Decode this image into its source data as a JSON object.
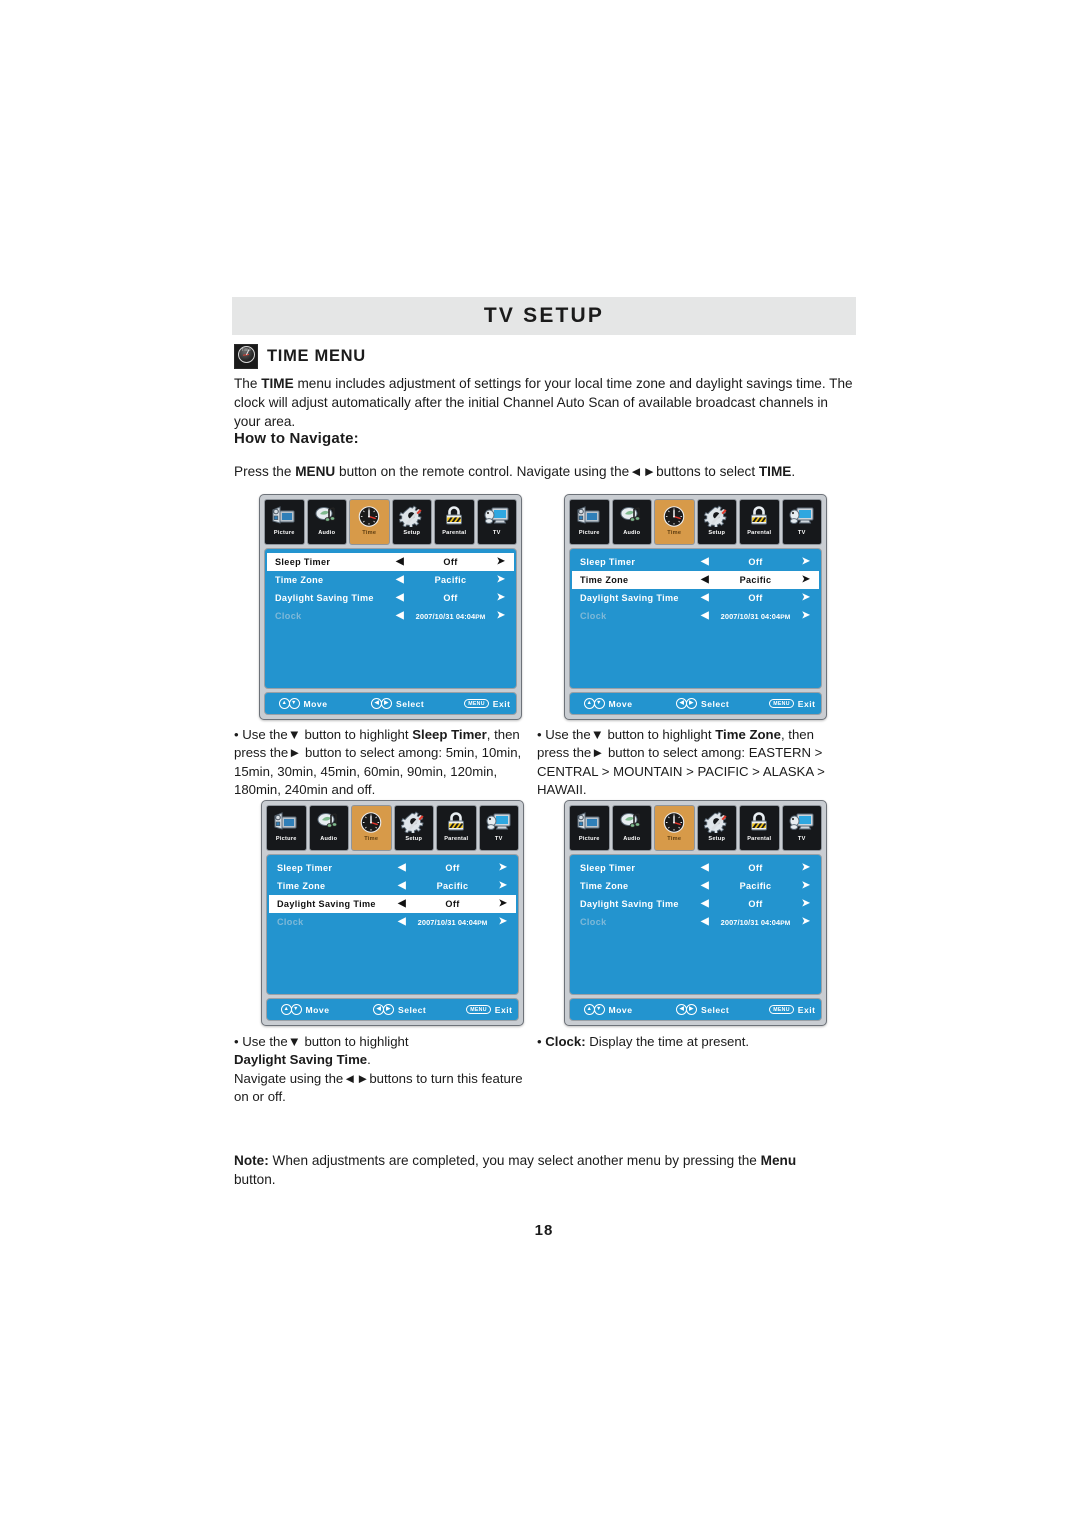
{
  "page": {
    "header_title": "TV SETUP",
    "page_number": "18"
  },
  "section": {
    "icon": "clock-icon",
    "icon_caption": "Time",
    "heading": "TIME MENU",
    "intro_html": "The <b>TIME</b> menu includes adjustment of settings for your local time zone and daylight savings time. The clock will adjust automatically after the initial Channel Auto Scan of available broadcast channels in your area.",
    "howto_heading": "How to Navigate:",
    "nav_html": "Press the <b>MENU</b> button on the remote control. Navigate using the&#9668;&#9658;buttons to select <b>TIME</b>."
  },
  "osd_common": {
    "tabs": [
      {
        "label": "Picture",
        "icon": "picture-icon",
        "active": false
      },
      {
        "label": "Audio",
        "icon": "audio-icon",
        "active": false
      },
      {
        "label": "Time",
        "icon": "clock-icon",
        "active": true
      },
      {
        "label": "Setup",
        "icon": "setup-gear-icon",
        "active": false
      },
      {
        "label": "Parental",
        "icon": "padlock-icon",
        "active": false
      },
      {
        "label": "TV",
        "icon": "tv-icon",
        "active": false
      }
    ],
    "rows": [
      {
        "name": "Sleep Timer",
        "value": "Off"
      },
      {
        "name": "Time Zone",
        "value": "Pacific"
      },
      {
        "name": "Daylight Saving Time",
        "value": "Off"
      },
      {
        "name": "Clock",
        "value": "2007/10/31 04:04 PM",
        "dim": true
      }
    ],
    "arrow_left": "◀",
    "arrow_right": "➤",
    "footer": {
      "move_label": "Move",
      "move_icons": [
        "▲",
        "▼"
      ],
      "select_label": "Select",
      "select_icons": [
        "◀",
        "▶"
      ],
      "exit_label": "Exit",
      "exit_button": "MENU"
    },
    "colors": {
      "osd_blue": "#2394cf",
      "tab_active_orange": "#d79a49",
      "panel_frame": "#c9cdd2",
      "selected_row": "#ffffff",
      "dim_text": "#7fb9d8",
      "header_band": "#e5e6e6"
    }
  },
  "osd_panels": [
    {
      "id": "osd1",
      "selected_index": 0
    },
    {
      "id": "osd2",
      "selected_index": 1
    },
    {
      "id": "osd3",
      "selected_index": 2
    },
    {
      "id": "osd4",
      "selected_index": -1
    }
  ],
  "captions": {
    "sleep_timer_html": "&bull; Use the&#9660; button to highlight <b>Sleep Timer</b>, then press the&#9658; button to select among: 5min, 10min, 15min, 30min, 45min, 60min, 90min, 120min, 180min, 240min and off.",
    "time_zone_html": "&bull; Use the&#9660; button to highlight <b>Time Zone</b>, then press the&#9658; button to select among: EASTERN &gt; CENTRAL &gt; MOUNTAIN &gt; PACIFIC &gt; ALASKA &gt; HAWAII.",
    "daylight_html": "&bull; Use the&#9660; button to highlight <br><b>Daylight Saving Time</b>.<br>Navigate using the&#9668;&#9658;buttons to turn this feature on or off.",
    "clock_html": "&bull; <b>Clock:</b> Display the time at present."
  },
  "note": {
    "text_html": "<b>Note:</b> When adjustments are completed, you may select another menu by pressing the <b>Menu</b> button."
  }
}
